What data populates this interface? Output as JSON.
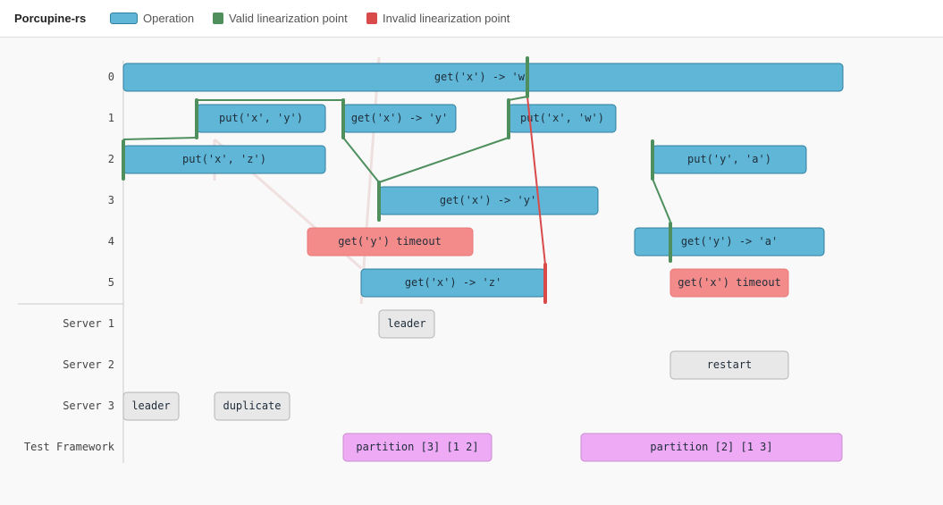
{
  "app": {
    "title": "Porcupine-rs"
  },
  "legend": [
    {
      "label": "Operation",
      "color": "#5fb6d6",
      "border": "#2f7f9e",
      "shape": "pill"
    },
    {
      "label": "Valid linearization point",
      "color": "#4e8f5d",
      "border": "#4e8f5d",
      "shape": "square"
    },
    {
      "label": "Invalid linearization point",
      "color": "#d94a4a",
      "border": "#d94a4a",
      "shape": "square"
    }
  ],
  "colors": {
    "operation": "#5fb6d6",
    "operation_border": "#2f7f9e",
    "timeout": "#f48b8b",
    "timeout_border": "#e87a7a",
    "event": "#e8e8e8",
    "event_border": "#b4b4b4",
    "framework": "#eeaaf5",
    "framework_border": "#c98fd0",
    "valid_line": "#4e8f5d",
    "invalid_line": "#d94a4a"
  },
  "rows": [
    "0",
    "1",
    "2",
    "3",
    "4",
    "5",
    "Server 1",
    "Server 2",
    "Server 3",
    "Test Framework"
  ],
  "operations": [
    {
      "row": 0,
      "label": "get('x') -> 'w'",
      "kind": "operation"
    },
    {
      "row": 1,
      "label": "put('x', 'y')",
      "kind": "operation"
    },
    {
      "row": 1,
      "label": "get('x') -> 'y'",
      "kind": "operation"
    },
    {
      "row": 1,
      "label": "put('x', 'w')",
      "kind": "operation"
    },
    {
      "row": 2,
      "label": "put('x', 'z')",
      "kind": "operation"
    },
    {
      "row": 2,
      "label": "put('y', 'a')",
      "kind": "operation"
    },
    {
      "row": 3,
      "label": "get('x') -> 'y'",
      "kind": "operation"
    },
    {
      "row": 4,
      "label": "get('y') timeout",
      "kind": "timeout"
    },
    {
      "row": 4,
      "label": "get('y') -> 'a'",
      "kind": "operation"
    },
    {
      "row": 5,
      "label": "get('x') -> 'z'",
      "kind": "operation"
    },
    {
      "row": 5,
      "label": "get('x') timeout",
      "kind": "timeout"
    },
    {
      "row": 6,
      "label": "leader",
      "kind": "event"
    },
    {
      "row": 7,
      "label": "restart",
      "kind": "event"
    },
    {
      "row": 8,
      "label": "leader",
      "kind": "event"
    },
    {
      "row": 8,
      "label": "duplicate",
      "kind": "event"
    },
    {
      "row": 9,
      "label": "partition [3] [1 2]",
      "kind": "framework"
    },
    {
      "row": 9,
      "label": "partition [2] [1 3]",
      "kind": "framework"
    }
  ]
}
